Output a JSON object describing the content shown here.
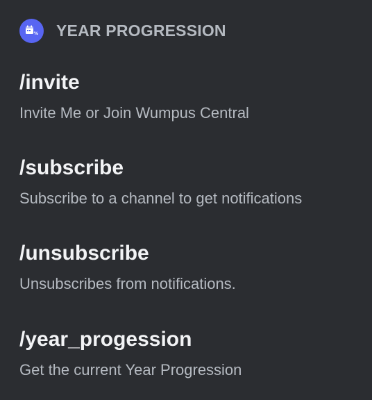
{
  "app": {
    "icon": "calendar-percent-icon",
    "name": "YEAR PROGRESSION",
    "accent_color": "#5865f2"
  },
  "commands": [
    {
      "name": "/invite",
      "description": "Invite Me or Join Wumpus Central"
    },
    {
      "name": "/subscribe",
      "description": "Subscribe to a channel to get notifications"
    },
    {
      "name": "/unsubscribe",
      "description": "Unsubscribes from notifications."
    },
    {
      "name": "/year_progession",
      "description": "Get the current Year Progression"
    }
  ],
  "colors": {
    "background": "#2b2d31",
    "command_text": "#f2f3f5",
    "muted_text": "#b5bac1"
  }
}
